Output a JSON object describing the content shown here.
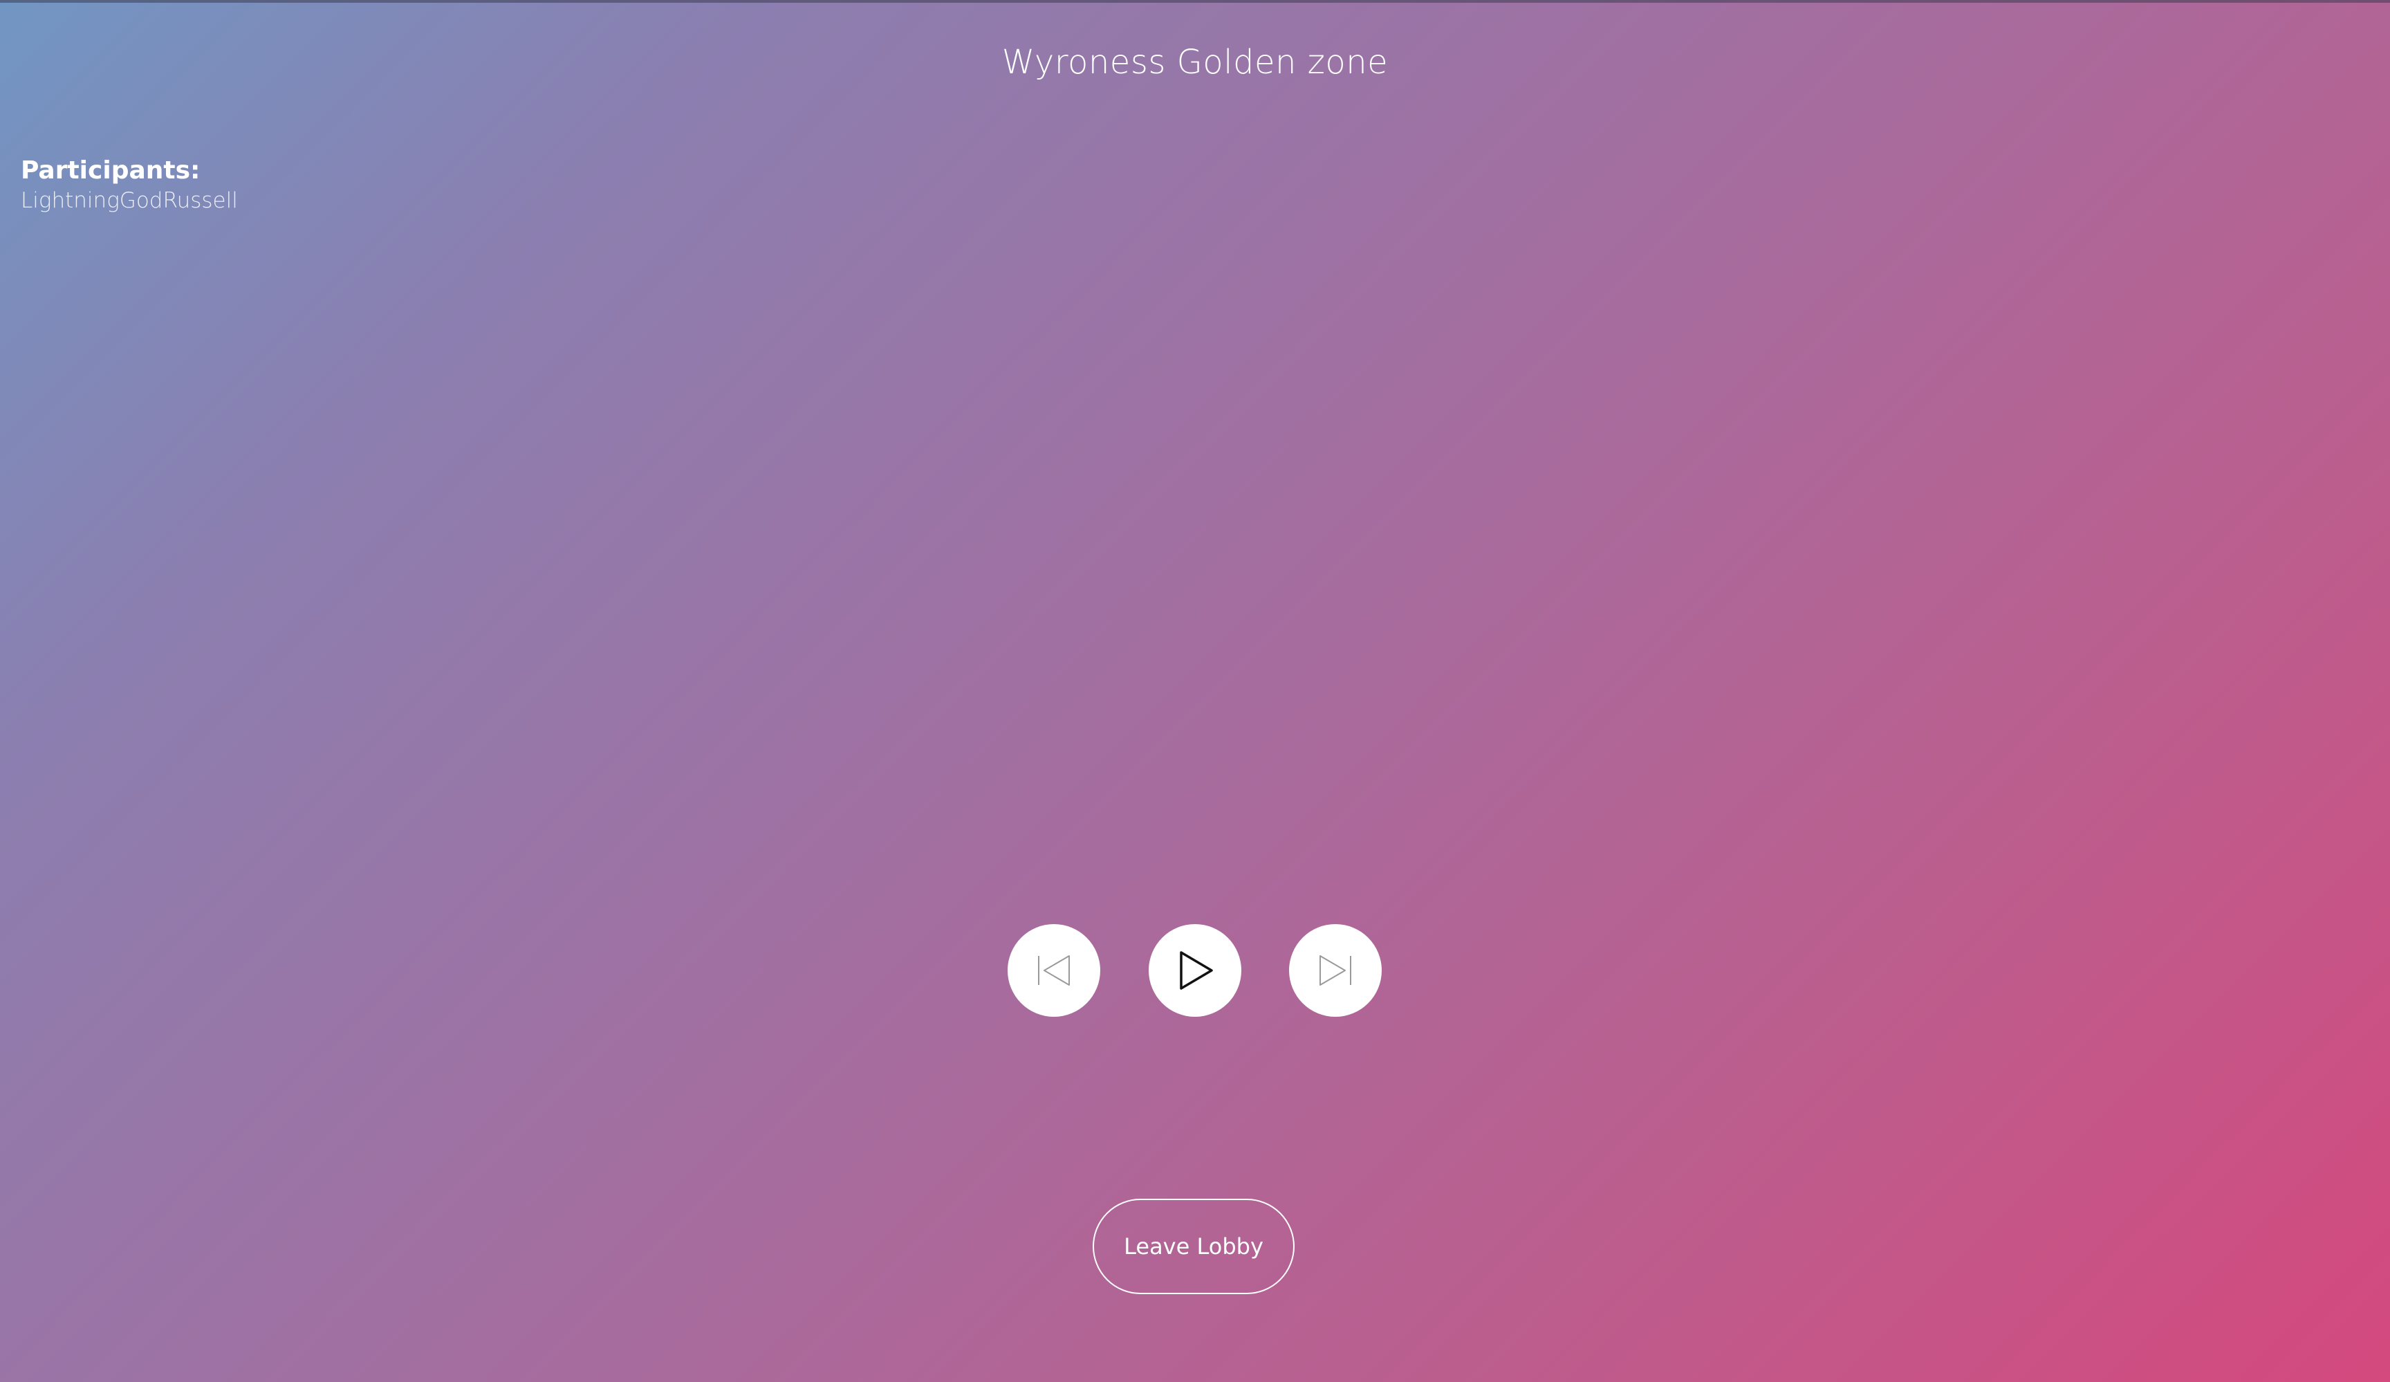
{
  "lobby": {
    "title": "Wyroness Golden zone"
  },
  "participants": {
    "heading": "Participants:",
    "names": [
      "LightningGodRussell"
    ]
  },
  "controls": {
    "previous_icon": "skip-previous-icon",
    "play_icon": "play-icon",
    "next_icon": "skip-next-icon"
  },
  "actions": {
    "leave_label": "Leave Lobby"
  },
  "colors": {
    "gradient_start": "#7296c3",
    "gradient_end": "#d4497e",
    "button_fill": "#ffffff"
  }
}
